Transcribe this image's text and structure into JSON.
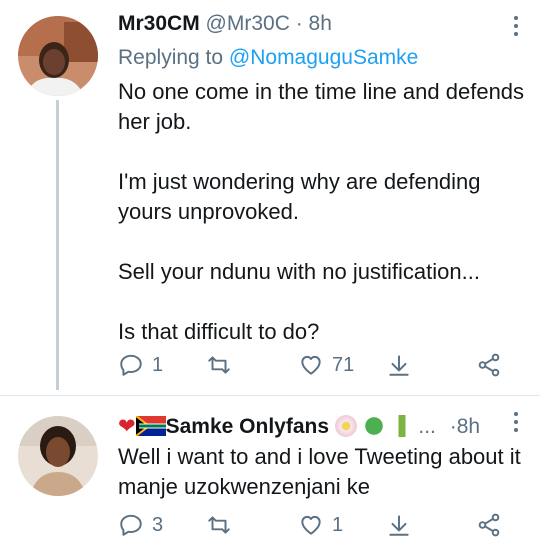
{
  "tweet1": {
    "display_name": "Mr30CM",
    "handle": "@Mr30C",
    "separator": "·",
    "time": "8h",
    "replying_prefix": "Replying to",
    "replying_to": "@NomaguguSamke",
    "body": [
      "No one come in the time line and defends",
      "her job.",
      "",
      "I'm just wondering why are defending",
      "yours unprovoked.",
      "",
      "Sell your ndunu with no justification...",
      "",
      "Is that difficult to do?"
    ],
    "actions": {
      "replies": "1",
      "retweets": "",
      "likes": "71"
    },
    "icons": [
      "reply-icon",
      "retweet-icon",
      "like-icon",
      "download-icon",
      "share-icon",
      "more-icon"
    ]
  },
  "tweet2": {
    "display_name": "Samke Onlyfans",
    "name_emojis_prefix": [
      "red-heart",
      "south-africa-flag"
    ],
    "name_emojis_suffix": [
      "blossom",
      "shamrock",
      "bamboo"
    ],
    "ellipsis": "...",
    "separator": "·",
    "time": "8h",
    "body": [
      "Well i want to and i love Tweeting about it",
      "manje uzokwenzenjani ke"
    ],
    "actions": {
      "replies": "3",
      "retweets": "",
      "likes": "1"
    }
  },
  "colors": {
    "text": "#14171a",
    "secondary": "#5b7083",
    "link": "#1da1f2",
    "thread_line": "#c4cfd6"
  }
}
